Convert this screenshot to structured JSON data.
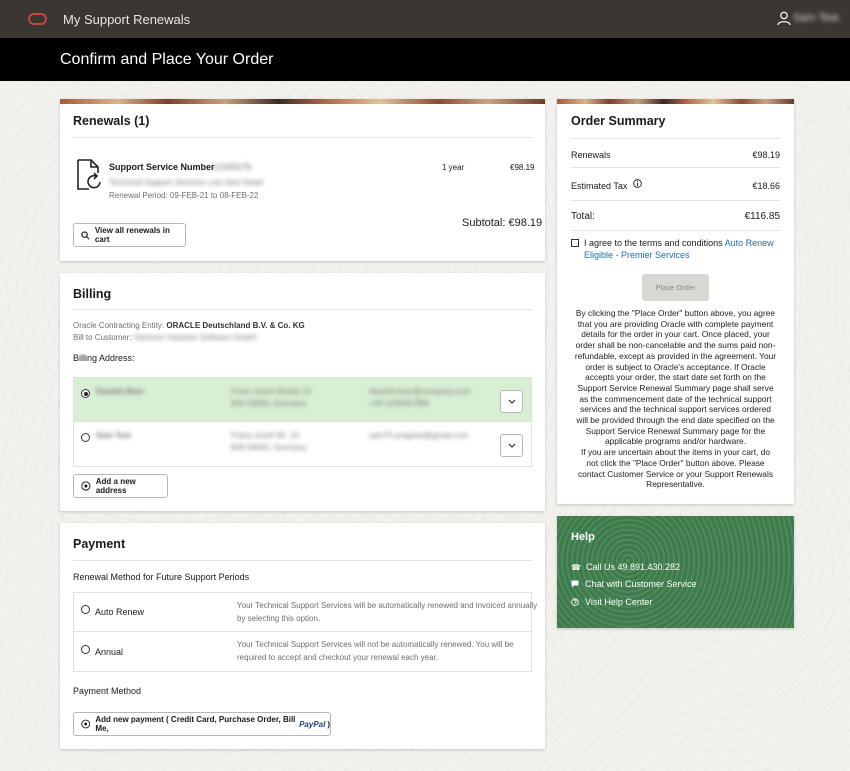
{
  "topbar": {
    "app_title": "My Support Renewals",
    "user_name": "Sam Test"
  },
  "page_title": "Confirm and Place Your Order",
  "renewals": {
    "title": "Renewals (1)",
    "support_label": "Support Service Number",
    "support_number": "12345678",
    "blurred_line": "Technical Support Services Line Item Detail",
    "renewal_period": "Renewal Period: 09-FEB-21 to 08-FEB-22",
    "term": "1 year",
    "amount": "€98.19",
    "subtotal": "Subtotal: €98.19",
    "view_all": "View all renewals in cart"
  },
  "billing": {
    "title": "Billing",
    "entity_label": "Oracle Contracting Entity: ",
    "entity_value": "ORACLE Deutschland B.V. & Co. KG",
    "bill_to_label": "Bill to Customer: ",
    "bill_to_value": "Hammer Industrie Software GmbH",
    "address_label": "Billing Address:",
    "addresses": [
      {
        "name": "Daniela Beer",
        "street": "Franz-Josef-Straße 10",
        "city": "806-59650, Germany",
        "email": "daniela.beer@company.com",
        "phone": "+49 1234567890"
      },
      {
        "name": "Sam Test",
        "street": "Franz-Josef-Str. 10",
        "city": "806-59650, Germany",
        "email": "sam75.pregtest@gmail.com",
        "phone": ""
      }
    ],
    "add_address": "Add a new address"
  },
  "payment": {
    "title": "Payment",
    "method_heading": "Renewal Method for Future Support Periods",
    "options": [
      {
        "label": "Auto Renew",
        "desc1": "Your Technical Support Services will be automatically renewed and invoiced annually",
        "desc2": "by selecting this option."
      },
      {
        "label": "Annual",
        "desc1": "Your Technical Support Services will not be automatically renewed. You will be",
        "desc2": "required to accept and checkout your renewal each year."
      }
    ],
    "payment_method_label": "Payment Method",
    "add_payment": "Add new payment ( Credit Card, Purchase Order, Bill Me, ",
    "paypal": "PayPal",
    "add_payment_close": " )"
  },
  "summary": {
    "title": "Order Summary",
    "renewals_label": "Renewals",
    "renewals_value": "€98.19",
    "tax_label": "Estimated Tax",
    "tax_value": "€18.66",
    "total_label": "Total:",
    "total_value": "€116.85",
    "terms_text": "I agree to the terms and conditions ",
    "terms_link1": "Auto Renew",
    "terms_link2": "Eligible - Premier Services",
    "place_order": "Place Order",
    "disclaimer": [
      "By clicking the \"Place Order\" button above, you agree",
      "that you are providing Oracle with complete payment",
      "details for the order in your cart. Once placed, your",
      "order shall be non-cancelable and the sums paid non-",
      "refundable, except as provided in the agreement. Your",
      "order is subject to Oracle's acceptance. If Oracle",
      "accepts your order, the start date set forth on the",
      "Support Service Renewal Summary page shall serve",
      "as the commencement date of the technical support",
      "services and the technical support services ordered",
      "will be provided through the end date specified on the",
      "Support Service Renewal Summary page for the",
      "applicable programs and/or hardware.",
      "If you are uncertain about the items in your cart, do",
      "not click the \"Place Order\" button above. Please",
      "contact Customer Service or your Support Renewals",
      "Representative."
    ]
  },
  "help": {
    "title": "Help",
    "call": "Call Us 49.891.430.282",
    "chat": "Chat with Customer Service",
    "visit": "Visit Help Center"
  },
  "colors": {
    "topbar": "#3a3632",
    "titlebar": "#000000",
    "selected_address": "#d9efd4",
    "link": "#1d6fa3",
    "help_green": "#3f7a4c",
    "oracle_red": "#c74634"
  }
}
